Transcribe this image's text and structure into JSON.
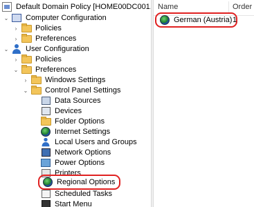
{
  "tree": {
    "root": {
      "label": "Default Domain Policy [HOME00DC001.HOME"
    },
    "computer_config": {
      "label": "Computer Configuration"
    },
    "cc_policies": {
      "label": "Policies"
    },
    "cc_preferences": {
      "label": "Preferences"
    },
    "user_config": {
      "label": "User Configuration"
    },
    "uc_policies": {
      "label": "Policies"
    },
    "uc_preferences": {
      "label": "Preferences"
    },
    "windows_settings": {
      "label": "Windows Settings"
    },
    "control_panel_settings": {
      "label": "Control Panel Settings"
    },
    "cp_items": [
      {
        "label": "Data Sources",
        "icon": "data-sources-icon"
      },
      {
        "label": "Devices",
        "icon": "devices-icon"
      },
      {
        "label": "Folder Options",
        "icon": "folder-options-icon"
      },
      {
        "label": "Internet Settings",
        "icon": "internet-settings-icon"
      },
      {
        "label": "Local Users and Groups",
        "icon": "local-users-icon"
      },
      {
        "label": "Network Options",
        "icon": "network-options-icon"
      },
      {
        "label": "Power Options",
        "icon": "power-options-icon"
      },
      {
        "label": "Printers",
        "icon": "printers-icon"
      },
      {
        "label": "Regional Options",
        "icon": "globe-icon",
        "selected": true
      },
      {
        "label": "Scheduled Tasks",
        "icon": "scheduled-tasks-icon"
      },
      {
        "label": "Start Menu",
        "icon": "start-menu-icon"
      }
    ]
  },
  "list": {
    "columns": [
      "Name",
      "Order"
    ],
    "rows": [
      {
        "name": "German (Austria)",
        "order": "1",
        "icon": "globe-icon"
      }
    ]
  },
  "colors": {
    "highlight_ring": "#e02020"
  }
}
